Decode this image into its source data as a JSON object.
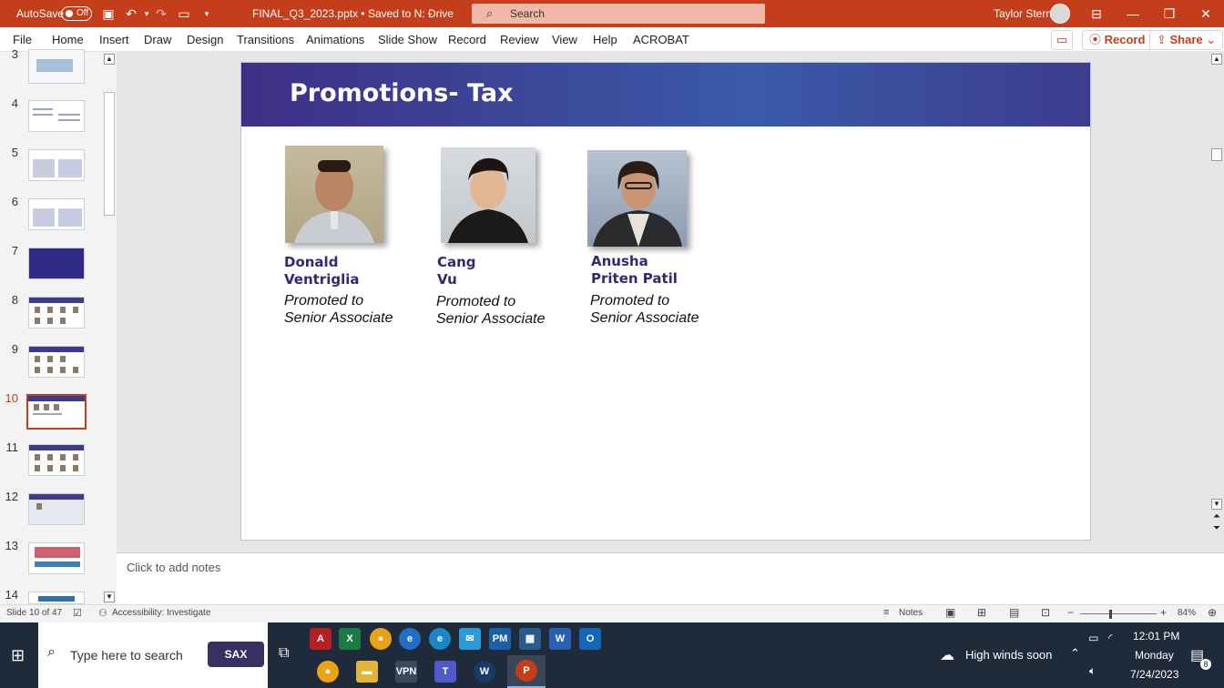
{
  "titlebar": {
    "autosave_label": "AutoSave",
    "autosave_state": "Off",
    "filename": "FINAL_Q3_2023.pptx • Saved to N: Drive",
    "search_placeholder": "Search",
    "user": "Taylor Stern"
  },
  "menu": [
    "File",
    "Home",
    "Insert",
    "Draw",
    "Design",
    "Transitions",
    "Animations",
    "Slide Show",
    "Record",
    "Review",
    "View",
    "Help",
    "ACROBAT"
  ],
  "buttons": {
    "record": "Record",
    "share": "Share"
  },
  "thumbnails": [
    "3",
    "4",
    "5",
    "6",
    "7",
    "8",
    "9",
    "10",
    "11",
    "12",
    "13",
    "14"
  ],
  "slide": {
    "title": "Promotions- Tax",
    "people": [
      {
        "name1": "Donald",
        "name2": "Ventriglia",
        "role1": "Promoted to",
        "role2": "Senior Associate"
      },
      {
        "name1": "Cang",
        "name2": "Vu",
        "role1": "Promoted to",
        "role2": "Senior Associate"
      },
      {
        "name1": "Anusha",
        "name2": "Priten Patil",
        "role1": "Promoted to",
        "role2": "Senior Associate"
      }
    ]
  },
  "notes_placeholder": "Click to add notes",
  "status": {
    "slide": "Slide 10 of 47",
    "accessibility": "Accessibility: Investigate",
    "notes": "Notes",
    "zoom": "84%"
  },
  "taskbar": {
    "search_placeholder": "Type here to search",
    "sax": "SAX",
    "weather": "High winds soon",
    "time": "12:01 PM",
    "day": "Monday",
    "date": "7/24/2023",
    "notif_count": "8"
  },
  "colors": {
    "accent": "#c43e1c",
    "slide_header": "#3e3a8e",
    "name_color": "#2e2a78",
    "taskbar": "#1f2a3a"
  }
}
